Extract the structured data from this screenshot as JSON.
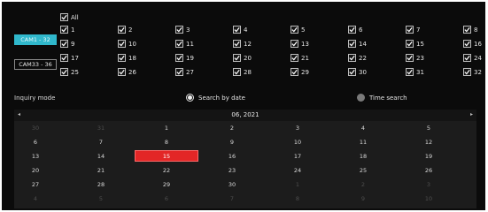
{
  "channels": {
    "all_label": "All",
    "groups": [
      {
        "button_label": "CAM1 - 32",
        "active": true
      },
      {
        "button_label": "CAM33 - 36",
        "active": false
      }
    ],
    "rows": [
      [
        "1",
        "2",
        "3",
        "4",
        "5",
        "6",
        "7",
        "8"
      ],
      [
        "9",
        "10",
        "11",
        "12",
        "13",
        "14",
        "15",
        "16"
      ],
      [
        "17",
        "18",
        "19",
        "20",
        "21",
        "22",
        "23",
        "24"
      ],
      [
        "25",
        "26",
        "27",
        "28",
        "29",
        "30",
        "31",
        "32"
      ]
    ]
  },
  "inquiry": {
    "label": "Inquiry mode",
    "options": [
      {
        "label": "Search by date",
        "selected": true
      },
      {
        "label": "Time search",
        "selected": false
      }
    ]
  },
  "calendar": {
    "title": "06‚ 2021",
    "prev_glyph": "◂",
    "next_glyph": "▸",
    "selected_day": "15",
    "weeks": [
      [
        {
          "d": "30",
          "muted": true
        },
        {
          "d": "31",
          "muted": true
        },
        {
          "d": "1"
        },
        {
          "d": "2"
        },
        {
          "d": "3"
        },
        {
          "d": "4"
        },
        {
          "d": "5"
        }
      ],
      [
        {
          "d": "6"
        },
        {
          "d": "7"
        },
        {
          "d": "8"
        },
        {
          "d": "9"
        },
        {
          "d": "10"
        },
        {
          "d": "11"
        },
        {
          "d": "12"
        }
      ],
      [
        {
          "d": "13"
        },
        {
          "d": "14"
        },
        {
          "d": "15",
          "selected": true
        },
        {
          "d": "16"
        },
        {
          "d": "17"
        },
        {
          "d": "18"
        },
        {
          "d": "19"
        }
      ],
      [
        {
          "d": "20"
        },
        {
          "d": "21"
        },
        {
          "d": "22"
        },
        {
          "d": "23"
        },
        {
          "d": "24"
        },
        {
          "d": "25"
        },
        {
          "d": "26"
        }
      ],
      [
        {
          "d": "27"
        },
        {
          "d": "28"
        },
        {
          "d": "29"
        },
        {
          "d": "30"
        },
        {
          "d": "1",
          "muted": true
        },
        {
          "d": "2",
          "muted": true
        },
        {
          "d": "3",
          "muted": true
        }
      ],
      [
        {
          "d": "4",
          "muted": true
        },
        {
          "d": "5",
          "muted": true
        },
        {
          "d": "6",
          "muted": true
        },
        {
          "d": "7",
          "muted": true
        },
        {
          "d": "8",
          "muted": true
        },
        {
          "d": "9",
          "muted": true
        },
        {
          "d": "10",
          "muted": true
        }
      ]
    ]
  },
  "colors": {
    "background": "#0b0b0b",
    "accent": "#30b8cc",
    "selected_day": "#e32626"
  }
}
